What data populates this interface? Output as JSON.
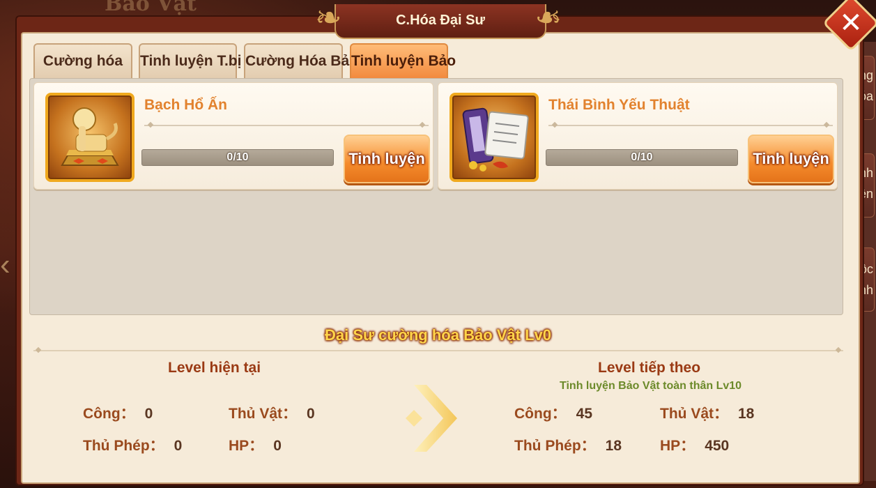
{
  "background": {
    "title_fragment": "Bảo Vật"
  },
  "right_panel": {
    "items": [
      "ờng",
      "óa",
      "inh",
      "yện",
      "uộc",
      "inh"
    ]
  },
  "dialog": {
    "title": "C.Hóa Đại Sư",
    "tabs": [
      {
        "label": "Cường hóa",
        "active": false
      },
      {
        "label": "Tinh luyện T.bị",
        "active": false
      },
      {
        "label": "Cường Hóa Bảo",
        "active": false
      },
      {
        "label": "Tinh luyện Bảo",
        "active": true
      }
    ]
  },
  "items": [
    {
      "name": "Bạch Hổ Ấn",
      "progress_text": "0/10",
      "progress": 0.0,
      "button": "Tinh luyện",
      "icon": "white-tiger-seal-icon"
    },
    {
      "name": "Thái Bình Yếu Thuật",
      "progress_text": "0/10",
      "progress": 0.0,
      "button": "Tinh luyện",
      "icon": "scroll-book-icon"
    }
  ],
  "master": {
    "title": "Đại Sư cường hóa Bảo Vật Lv0",
    "current": {
      "heading": "Level hiện tại",
      "stats": {
        "atk_label": "Công：",
        "atk_value": "0",
        "def_label": "Thủ Vật：",
        "def_value": "0",
        "mdef_label": "Thủ Phép：",
        "mdef_value": "0",
        "hp_label": "HP：",
        "hp_value": "0"
      }
    },
    "next": {
      "heading": "Level tiếp theo",
      "requirement": "Tinh luyện Bảo Vật toàn thân Lv10",
      "stats": {
        "atk_label": "Công：",
        "atk_value": "45",
        "def_label": "Thủ Vật：",
        "def_value": "18",
        "mdef_label": "Thủ Phép：",
        "mdef_value": "18",
        "hp_label": "HP：",
        "hp_value": "450"
      }
    }
  },
  "colors": {
    "accent": "#f28a3e",
    "panel": "#f6ebd9",
    "frame": "#6d2616",
    "highlight": "#ffd54a"
  }
}
